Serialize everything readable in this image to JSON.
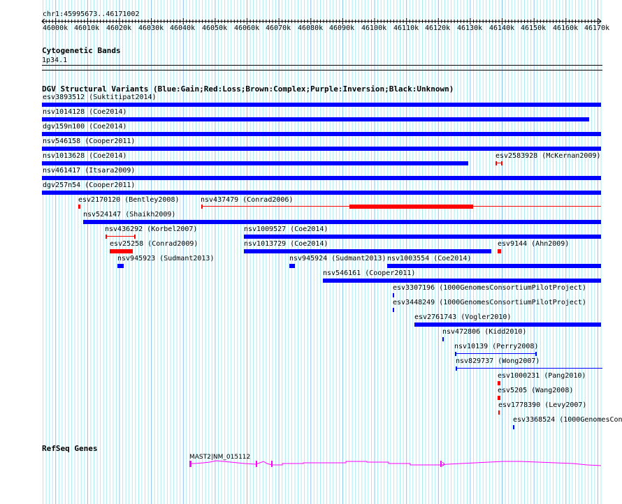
{
  "ruler": {
    "position": "chr1:45995673..46171002",
    "ticks": [
      "46000k",
      "46010k",
      "46020k",
      "46030k",
      "46040k",
      "46050k",
      "46060k",
      "46070k",
      "46080k",
      "46090k",
      "46100k",
      "46110k",
      "46120k",
      "46130k",
      "46140k",
      "46150k",
      "46160k",
      "46170k"
    ]
  },
  "cytoband": {
    "title": "Cytogenetic Bands",
    "band": "1p34.1"
  },
  "dgv": {
    "title": "DGV Structural Variants (Blue:Gain;Red:Loss;Brown:Complex;Purple:Inversion;Black:Unknown)",
    "features": [
      {
        "label": "esv3893512 (Suktitipat2014)",
        "type": "gain"
      },
      {
        "label": "nsv1014128 (Coe2014)",
        "type": "gain"
      },
      {
        "label": "dgv159n100 (Coe2014)",
        "type": "gain"
      },
      {
        "label": "nsv546158 (Cooper2011)",
        "type": "gain"
      },
      {
        "label": "nsv1013628 (Coe2014)",
        "type": "gain"
      },
      {
        "label": "esv2583928 (McKernan2009)",
        "type": "loss"
      },
      {
        "label": "nsv461417 (Itsara2009)",
        "type": "gain"
      },
      {
        "label": "dgv257n54 (Cooper2011)",
        "type": "gain"
      },
      {
        "label": "esv2170120 (Bentley2008)",
        "type": "loss"
      },
      {
        "label": "nsv437479 (Conrad2006)",
        "type": "loss"
      },
      {
        "label": "nsv524147 (Shaikh2009)",
        "type": "gain"
      },
      {
        "label": "nsv436292 (Korbel2007)",
        "type": "loss"
      },
      {
        "label": "nsv1009527 (Coe2014)",
        "type": "gain"
      },
      {
        "label": "esv25258 (Conrad2009)",
        "type": "loss"
      },
      {
        "label": "nsv1013729 (Coe2014)",
        "type": "gain"
      },
      {
        "label": "esv9144 (Ahn2009)",
        "type": "loss"
      },
      {
        "label": "nsv945923 (Sudmant2013)",
        "type": "gain"
      },
      {
        "label": "nsv945924 (Sudmant2013)",
        "type": "gain"
      },
      {
        "label": "nsv1003554 (Coe2014)",
        "type": "gain"
      },
      {
        "label": "nsv546161 (Cooper2011)",
        "type": "gain"
      },
      {
        "label": "esv3307196 (1000GenomesConsortiumPilotProject)",
        "type": "gain"
      },
      {
        "label": "esv3448249 (1000GenomesConsortiumPilotProject)",
        "type": "gain"
      },
      {
        "label": "esv2761743 (Vogler2010)",
        "type": "gain"
      },
      {
        "label": "nsv472806 (Kidd2010)",
        "type": "gain"
      },
      {
        "label": "nsv10139 (Perry2008)",
        "type": "gain"
      },
      {
        "label": "nsv829737 (Wong2007)",
        "type": "gain"
      },
      {
        "label": "esv1000231 (Pang2010)",
        "type": "loss"
      },
      {
        "label": "esv5205 (Wang2008)",
        "type": "loss"
      },
      {
        "label": "esv1778390 (Levy2007)",
        "type": "loss"
      },
      {
        "label": "esv3368524 (1000GenomesCon",
        "type": "gain"
      }
    ]
  },
  "refseq": {
    "title": "RefSeq Genes",
    "gene_label": "MAST2|NM_015112"
  },
  "colors": {
    "gain": "#0000ff",
    "loss": "#ff0000",
    "gene": "#ff00ff",
    "grid_minor": "#a8ecf0",
    "grid_major": "#88c4f0"
  }
}
